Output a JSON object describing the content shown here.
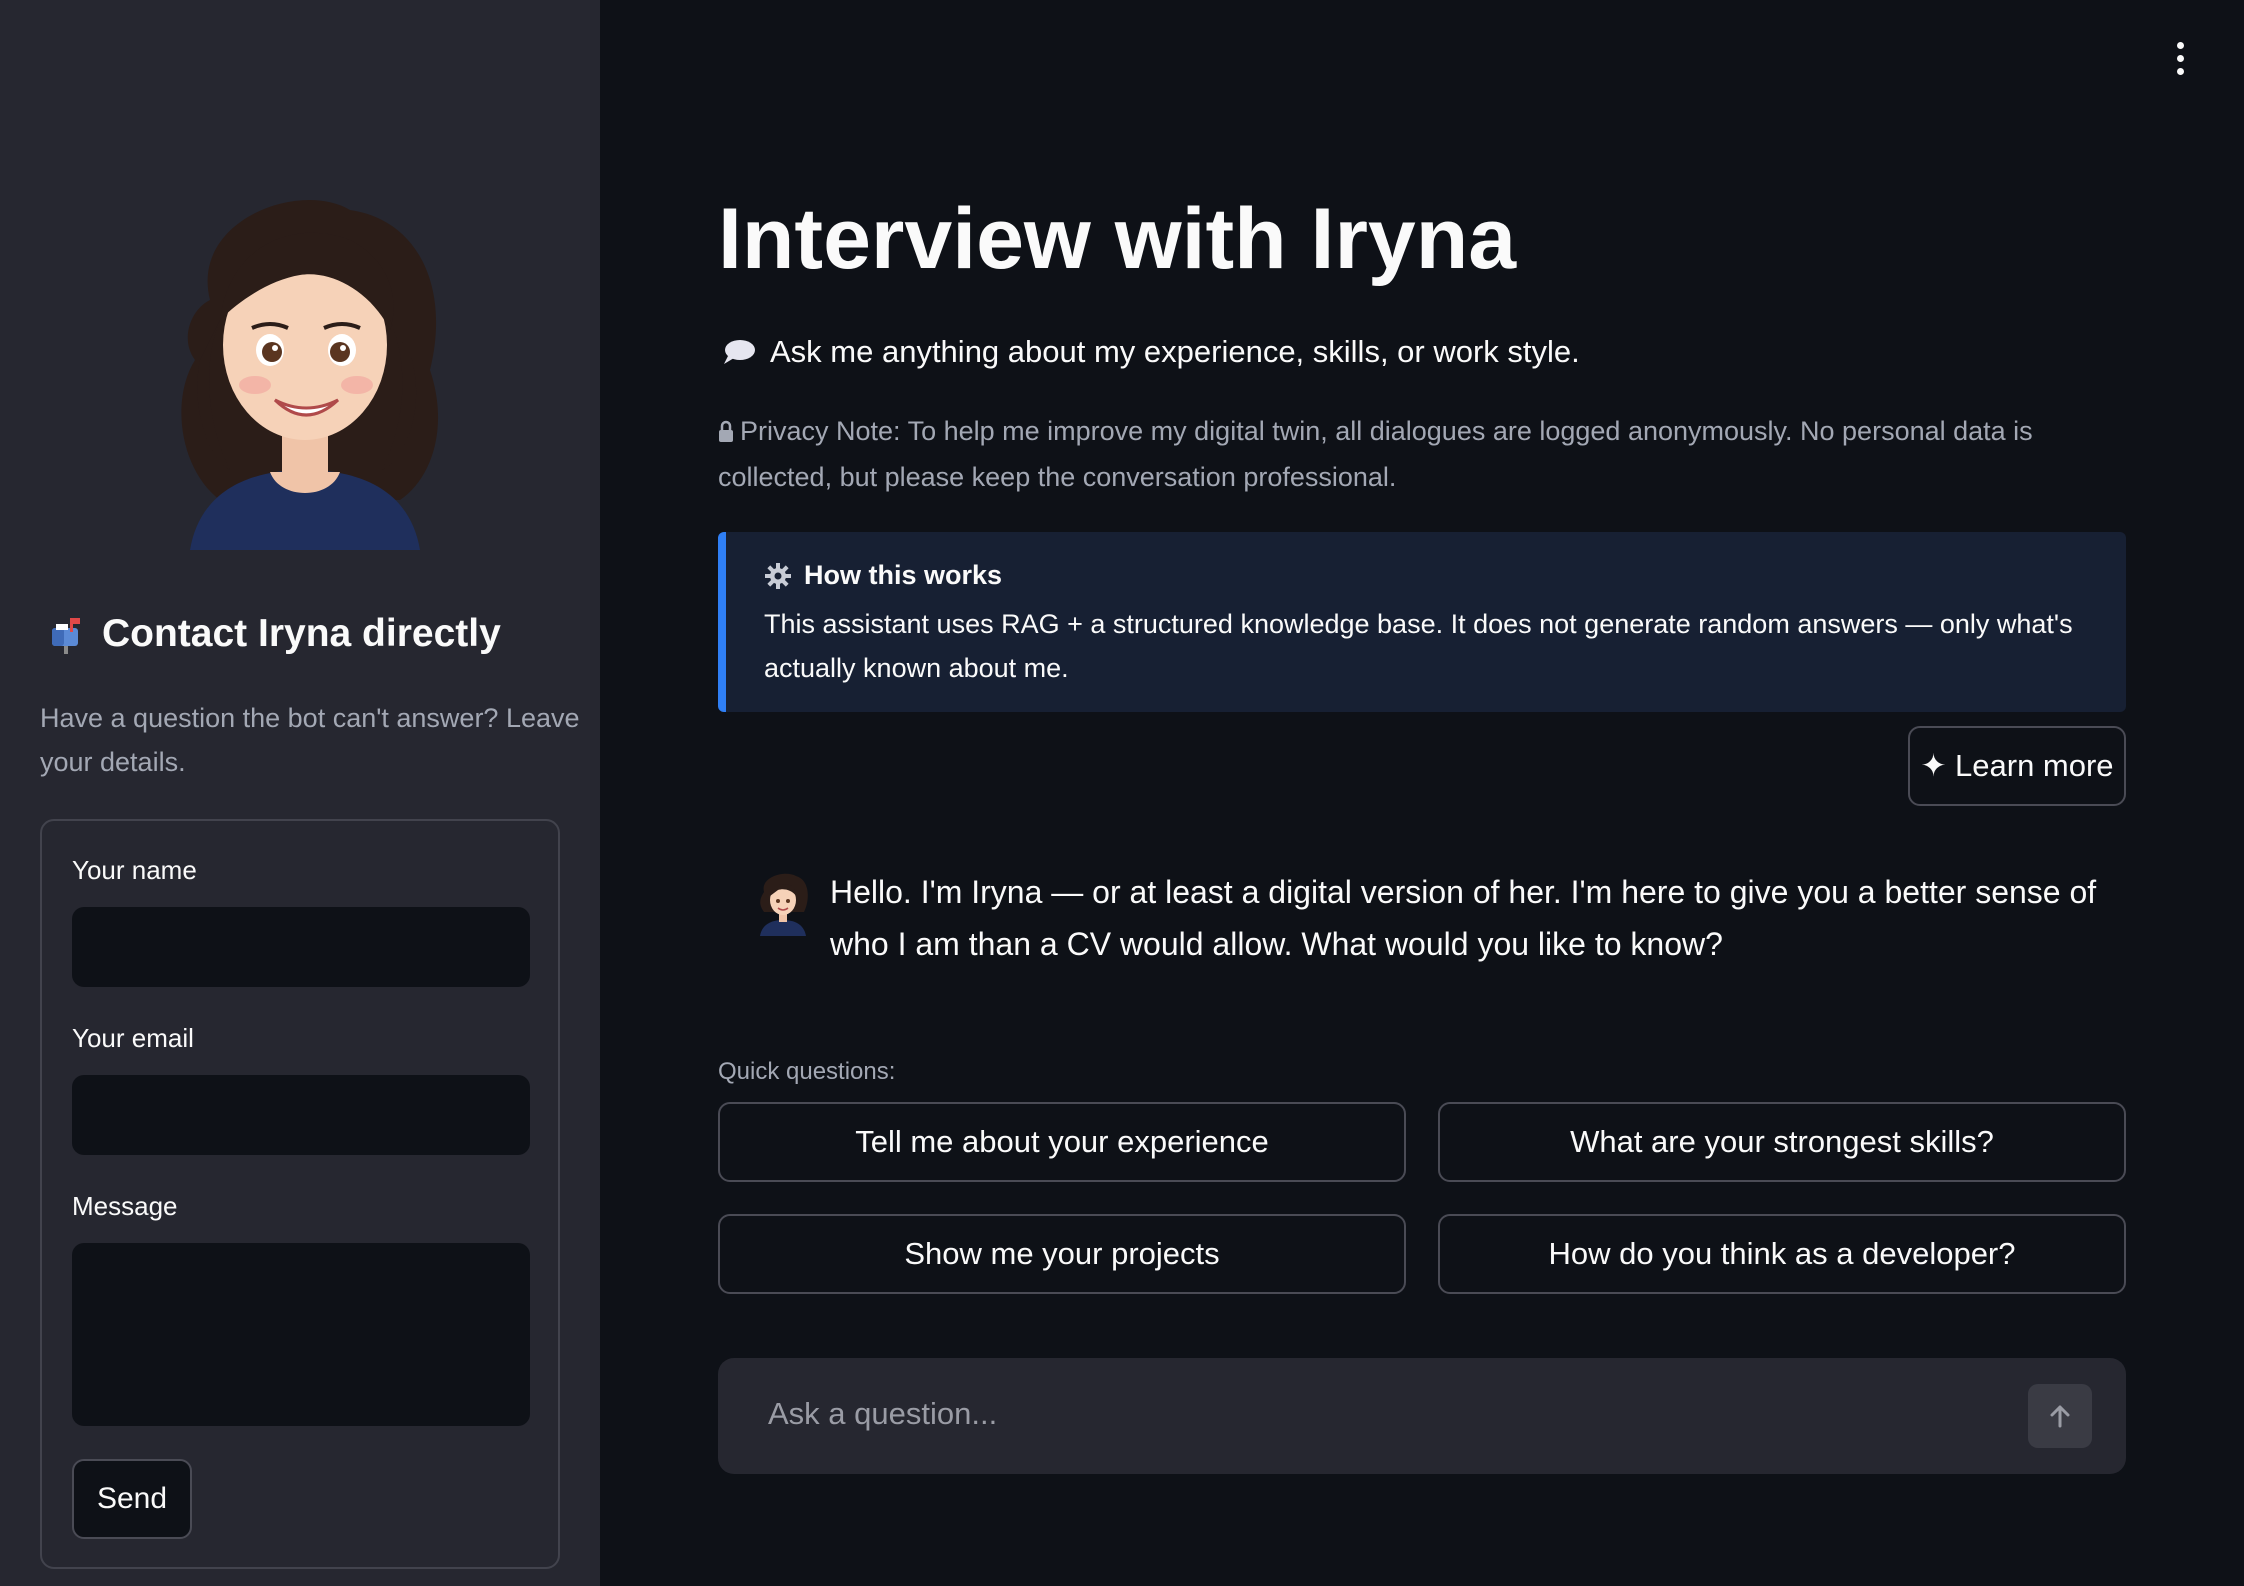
{
  "sidebar": {
    "contact_heading": "Contact Iryna directly",
    "contact_sub": "Have a question the bot can't answer? Leave your details.",
    "form": {
      "name_label": "Your name",
      "name_value": "",
      "email_label": "Your email",
      "email_value": "",
      "message_label": "Message",
      "message_value": "",
      "send_label": "Send"
    }
  },
  "main": {
    "title": "Interview with Iryna",
    "subtitle": "Ask me anything about my experience, skills, or work style.",
    "privacy_note": "Privacy Note: To help me improve my digital twin, all dialogues are logged anonymously. No personal data is collected, but please keep the conversation professional.",
    "info": {
      "title": "How this works",
      "body": "This assistant uses RAG + a structured knowledge base. It does not generate random answers — only what's actually known about me."
    },
    "learn_more": "✦ Learn more",
    "chat": {
      "assistant_message": "Hello. I'm Iryna — or at least a digital version of her. I'm here to give you a better sense of who I am than a CV would allow. What would you like to know?"
    },
    "quick_label": "Quick questions:",
    "quick_questions": [
      "Tell me about your experience",
      "What are your strongest skills?",
      "Show me your projects",
      "How do you think as a developer?"
    ],
    "input_placeholder": "Ask a question..."
  },
  "icons": {
    "menu": "more-vertical-icon",
    "mailbox": "mailbox-icon",
    "speech": "speech-bubble-icon",
    "lock": "lock-icon",
    "gear": "gear-icon",
    "send": "arrow-up-icon"
  },
  "colors": {
    "background": "#0e1117",
    "sidebar": "#262730",
    "info_bg": "#172033",
    "info_accent": "#2f7ff5"
  }
}
